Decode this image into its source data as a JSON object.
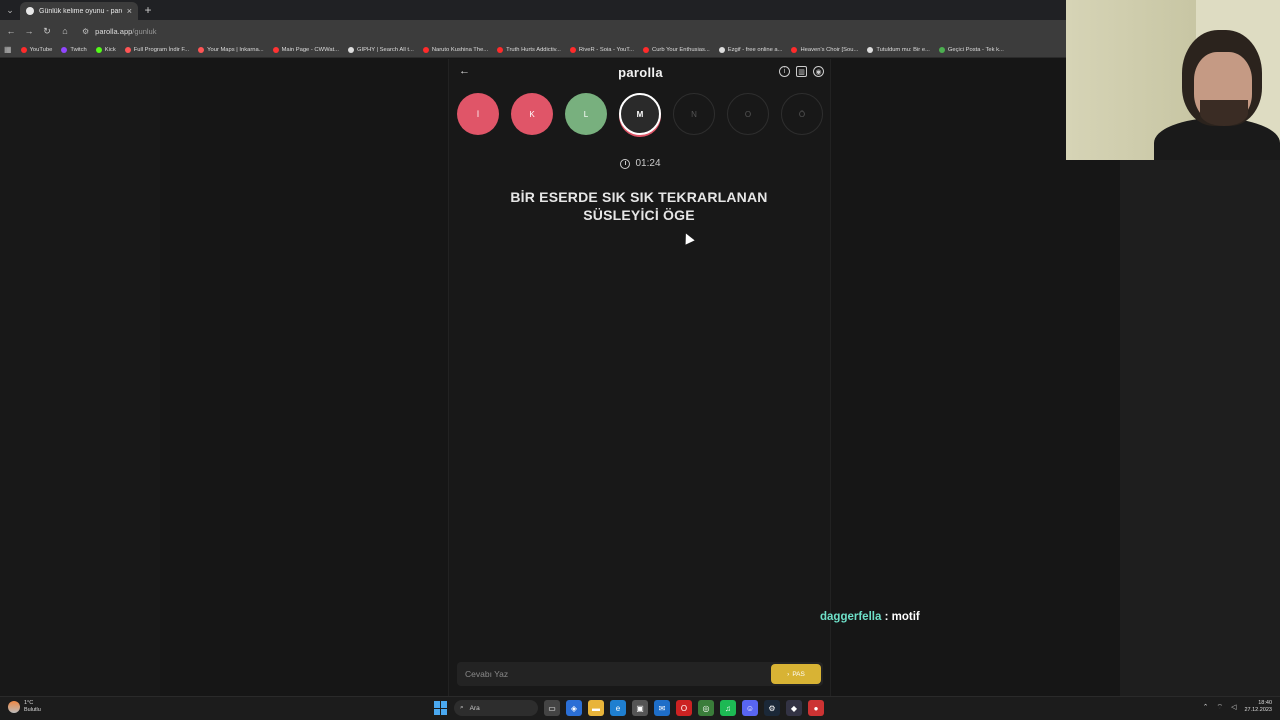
{
  "browser": {
    "tab_title": "Günlük kelime oyunu - parolla",
    "tab_close": "×",
    "new_tab": "+",
    "url_domain": "parolla.app",
    "url_path": "/gunluk",
    "bookmarks": [
      {
        "label": "YouTube",
        "color": "#ff2b2b"
      },
      {
        "label": "Twitch",
        "color": "#9146ff"
      },
      {
        "label": "Kick",
        "color": "#53fc18"
      },
      {
        "label": "Full Program İndir F...",
        "color": "#ff5555"
      },
      {
        "label": "Your Maps | Inkarna...",
        "color": "#ff5555"
      },
      {
        "label": "Main Page - CWWat...",
        "color": "#ff3333"
      },
      {
        "label": "GIPHY | Search All t...",
        "color": "#dddddd"
      },
      {
        "label": "Naruto Kushina The...",
        "color": "#ff2b2b"
      },
      {
        "label": "Truth Hurts Addictiv...",
        "color": "#ff2b2b"
      },
      {
        "label": "RiveR - Soia - YouT...",
        "color": "#ff2b2b"
      },
      {
        "label": "Curb Your Enthusias...",
        "color": "#ff2b2b"
      },
      {
        "label": "Ezgif - free online a...",
        "color": "#dddddd"
      },
      {
        "label": "Heaven's Choir [Sou...",
        "color": "#ff2b2b"
      },
      {
        "label": "Tutuldum mu: Bir e...",
        "color": "#dddddd"
      },
      {
        "label": "Geçici Posta - Tek k...",
        "color": "#4caf50"
      }
    ]
  },
  "app": {
    "logo": "parolla",
    "letters": [
      {
        "char": "İ",
        "state": "wrong"
      },
      {
        "char": "K",
        "state": "wrong"
      },
      {
        "char": "L",
        "state": "right"
      },
      {
        "char": "M",
        "state": "current"
      },
      {
        "char": "N",
        "state": "pending"
      },
      {
        "char": "O",
        "state": "pending"
      },
      {
        "char": "Ö",
        "state": "pending"
      }
    ],
    "timer": "01:24",
    "question_line1": "BİR ESERDE SIK SIK TEKRARLANAN",
    "question_line2": "SÜSLEYİCİ ÖGE",
    "answer_placeholder": "Cevabı Yaz",
    "pass_button": "PAS",
    "colors": {
      "wrong": "#e05568",
      "right": "#78b07e",
      "pass": "#d8b334"
    }
  },
  "chat": {
    "user": "daggerfella",
    "separator": ":",
    "message": "motif"
  },
  "taskbar": {
    "weather_temp": "1°C",
    "weather_desc": "Bulutlu",
    "search_label": "Ara",
    "time": "18:40",
    "date": "27.12.2023"
  }
}
